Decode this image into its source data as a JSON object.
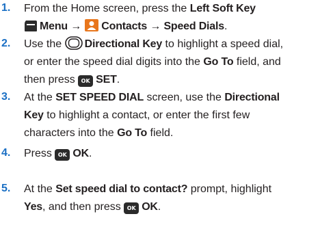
{
  "steps": [
    {
      "number": "1.",
      "l1_a": "From the Home screen, press the ",
      "l1_b": "Left Soft Key",
      "l2_a": "Menu",
      "l2_arrow1": " → ",
      "l2_b": "Contacts",
      "l2_arrow2": " → ",
      "l2_c": "Speed Dials",
      "l2_d": "."
    },
    {
      "number": "2.",
      "l1_a": "Use the ",
      "l1_b": "Directional Key",
      "l1_c": " to highlight a speed dial,",
      "l2_a": "or enter the speed dial digits into the ",
      "l2_b": "Go To",
      "l2_c": " field, and",
      "l3_a": "then press ",
      "l3_key": "OK",
      "l3_b": "SET",
      "l3_c": "."
    },
    {
      "number": "3.",
      "l1_a": "At the ",
      "l1_b": "SET SPEED DIAL",
      "l1_c": " screen, use the ",
      "l1_d": "Directional",
      "l2_a": "Key",
      "l2_b": " to highlight a contact, or enter the first few",
      "l3_a": "characters into the ",
      "l3_b": "Go To",
      "l3_c": " field."
    },
    {
      "number": "4.",
      "l1_a": "Press ",
      "l1_key": "OK",
      "l1_b": "OK",
      "l1_c": "."
    },
    {
      "number": "5.",
      "l1_a": "At the ",
      "l1_b": "Set speed dial to contact?",
      "l1_c": " prompt, highlight",
      "l2_a": "Yes",
      "l2_b": ", and then press ",
      "l2_key": "OK",
      "l2_c": "OK",
      "l2_d": "."
    }
  ],
  "colors": {
    "step_number": "#1a6fc4",
    "body_text": "#231f20",
    "contacts_icon": "#e8761c",
    "key_background": "#2b2b2b"
  }
}
